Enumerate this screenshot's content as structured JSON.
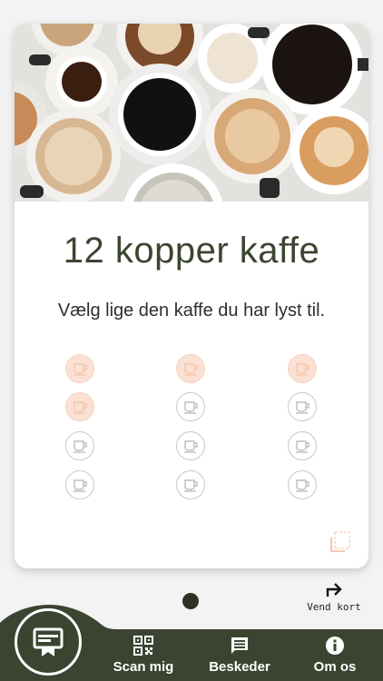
{
  "card": {
    "title": "12 kopper kaffe",
    "subtitle": "Vælg lige den kaffe du har lyst til.",
    "stamps_total": 12,
    "stamps_filled": 4,
    "stamp_colors": {
      "filled": "#fbe1d3",
      "empty": "#ffffff",
      "empty_stroke": "#c8c8c8",
      "filled_icon": "#f4c7ae"
    }
  },
  "flip": {
    "label": "Vend kort",
    "icon": "turn-right-arrow-icon"
  },
  "pager": {
    "pages": 1,
    "active": 1
  },
  "nav": {
    "background": "#3b4430",
    "fab_icon": "loyalty-card-icon",
    "items": [
      {
        "label": "Scan mig",
        "icon": "qr-code-icon"
      },
      {
        "label": "Beskeder",
        "icon": "message-icon"
      },
      {
        "label": "Om os",
        "icon": "info-icon"
      }
    ]
  }
}
